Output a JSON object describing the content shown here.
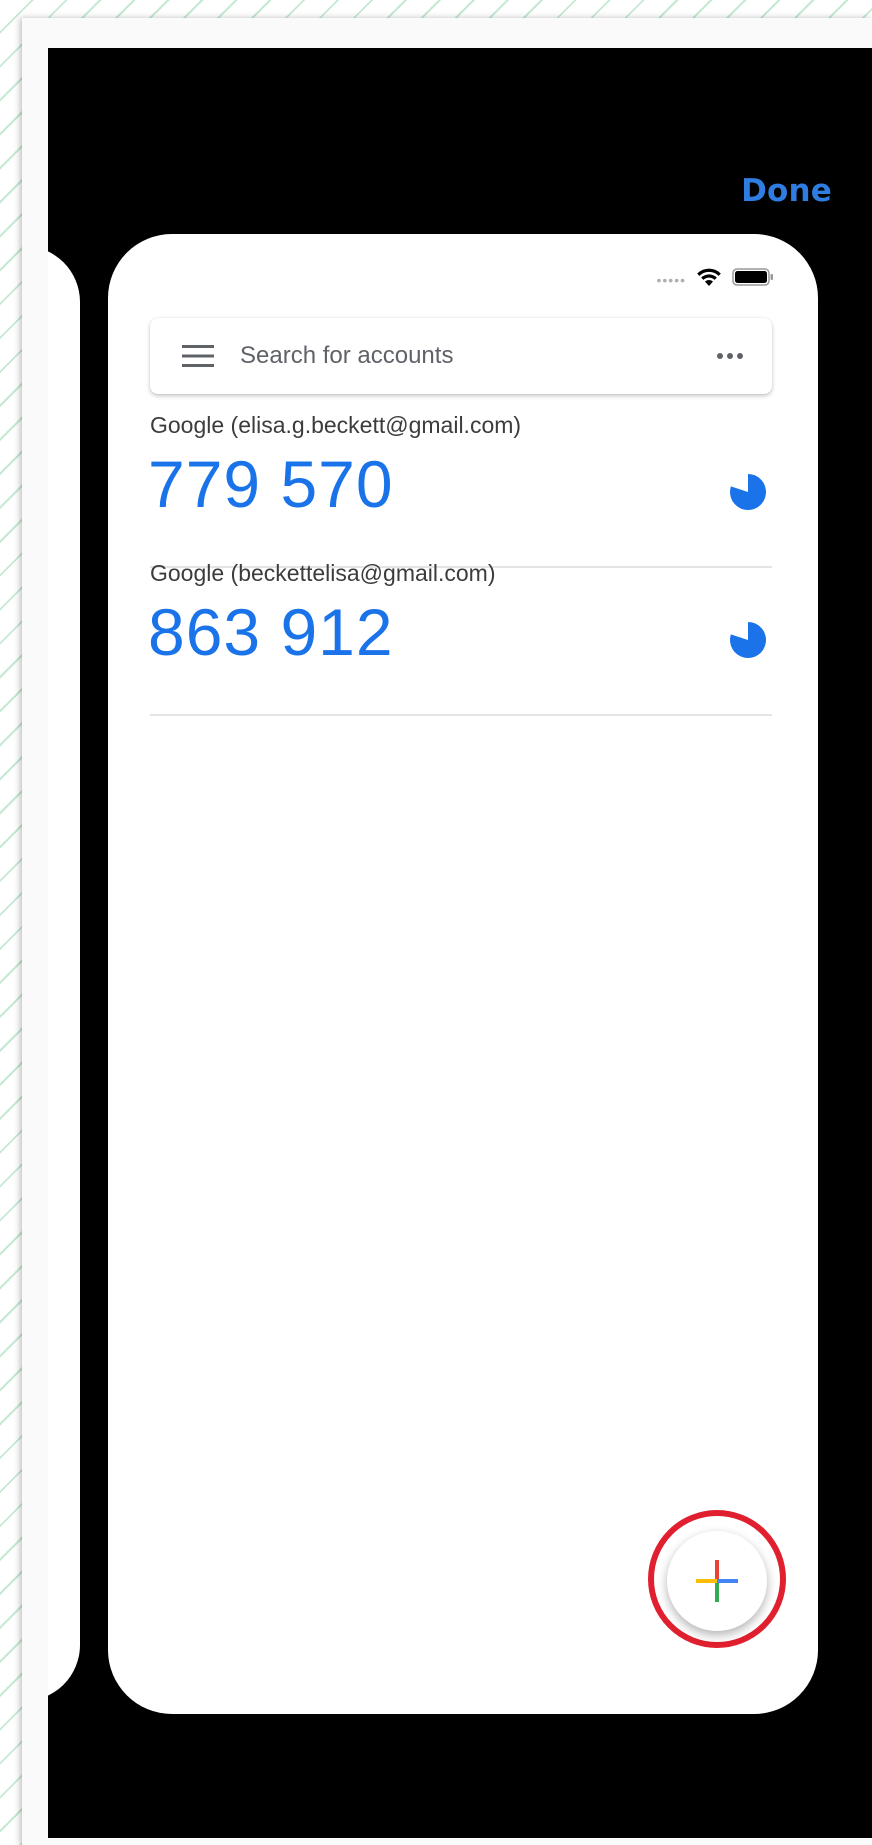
{
  "header": {
    "done_label": "Done"
  },
  "status_bar": {
    "signal_icon": "signal-dots-icon",
    "wifi_icon": "wifi-icon",
    "battery_icon": "battery-icon"
  },
  "search": {
    "placeholder": "Search for accounts",
    "menu_icon": "hamburger-menu-icon",
    "more_icon": "more-options-icon"
  },
  "accounts": [
    {
      "label": "Google (elisa.g.beckett@gmail.com)",
      "code": "779 570",
      "timer_icon": "countdown-timer-icon"
    },
    {
      "label": "Google (beckettelisa@gmail.com)",
      "code": "863 912",
      "timer_icon": "countdown-timer-icon"
    }
  ],
  "fab": {
    "icon": "add-plus-icon",
    "highlight_color": "#e0202e"
  },
  "colors": {
    "accent": "#1a73e8",
    "done": "#2f7de1",
    "background": "#000000",
    "plus_red": "#ea4335",
    "plus_blue": "#4285f4",
    "plus_green": "#34a853",
    "plus_yellow": "#fbbc05"
  }
}
